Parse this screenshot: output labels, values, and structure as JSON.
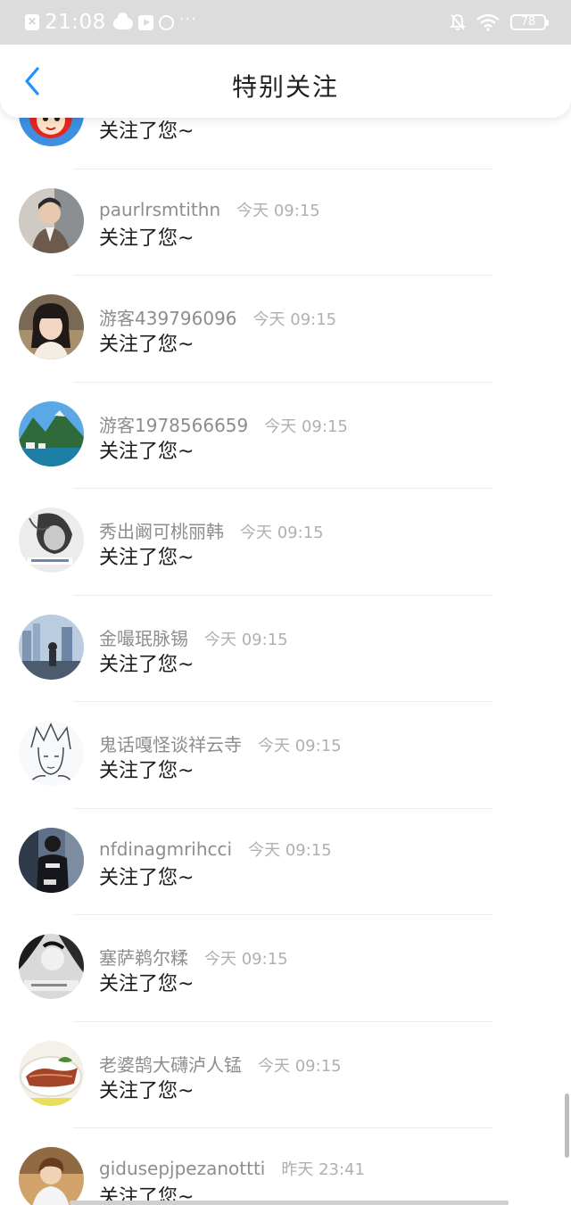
{
  "status_bar": {
    "time": "21:08",
    "battery": "78",
    "more": "···"
  },
  "header": {
    "title": "特别关注"
  },
  "items": [
    {
      "username": "",
      "time": "",
      "message": "关注了您~",
      "avatar": "cartoon-avatar"
    },
    {
      "username": "paurlrsmtithn",
      "time": "今天 09:15",
      "message": "关注了您~",
      "avatar": "male-avatar"
    },
    {
      "username": "游客439796096",
      "time": "今天 09:15",
      "message": "关注了您~",
      "avatar": "female-avatar"
    },
    {
      "username": "游客1978566659",
      "time": "今天 09:15",
      "message": "关注了您~",
      "avatar": "landscape-avatar"
    },
    {
      "username": "秀出阚可桃丽韩",
      "time": "今天 09:15",
      "message": "关注了您~",
      "avatar": "portrait-avatar"
    },
    {
      "username": "金嘬珉脉锡",
      "time": "今天 09:15",
      "message": "关注了您~",
      "avatar": "city-avatar"
    },
    {
      "username": "鬼话嘎怪谈祥云寺",
      "time": "今天 09:15",
      "message": "关注了您~",
      "avatar": "sketch-avatar"
    },
    {
      "username": "nfdinagmrihcci",
      "time": "今天 09:15",
      "message": "关注了您~",
      "avatar": "street-avatar"
    },
    {
      "username": "塞萨鹈尔糅",
      "time": "今天 09:15",
      "message": "关注了您~",
      "avatar": "bw-avatar"
    },
    {
      "username": "老婆鹄大礴泸人锰",
      "time": "今天 09:15",
      "message": "关注了您~",
      "avatar": "food-avatar"
    },
    {
      "username": "gidusepjpezanottti",
      "time": "昨天 23:41",
      "message": "关注了您~",
      "avatar": "boy-avatar"
    }
  ],
  "colors": {
    "accent": "#1e90ff",
    "status_bar_bg": "#dcdcdc",
    "username": "#8d8d8d",
    "timestamp": "#b0b0b0",
    "message": "#1c1c1c"
  }
}
